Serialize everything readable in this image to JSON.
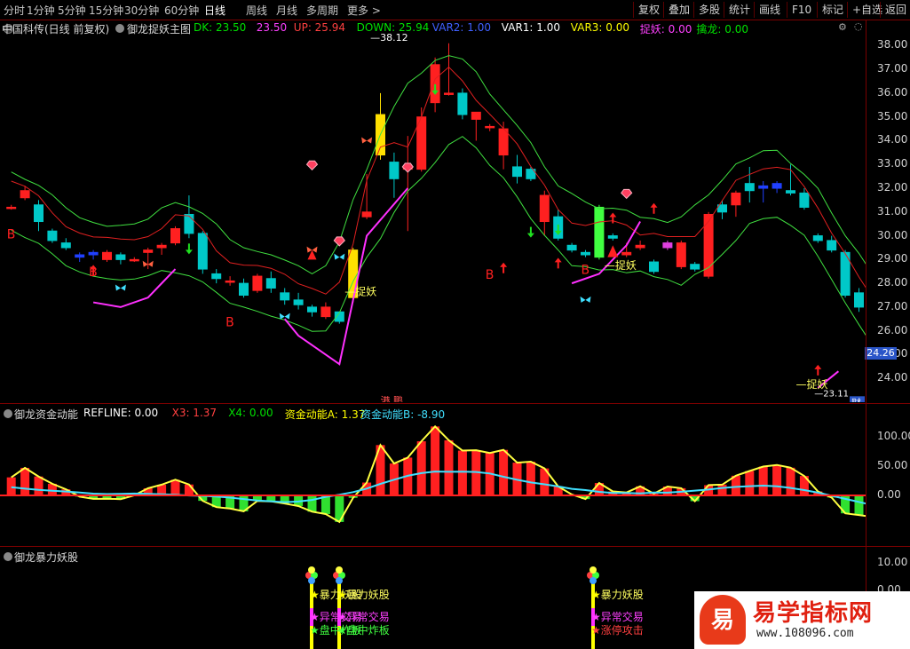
{
  "toolbar": {
    "periods": [
      "分时",
      "1分钟",
      "5分钟",
      "15分钟",
      "30分钟",
      "60分钟",
      "日线",
      "周线",
      "月线",
      "多周期",
      "更多 >"
    ],
    "active_period": "日线",
    "buttons": [
      "复权",
      "叠加",
      "多股",
      "统计",
      "画线",
      "F10",
      "标记",
      "+自选",
      "返回"
    ]
  },
  "main_info": {
    "stock": "中国科传(日线 前复权)",
    "indicator": "御龙捉妖主图",
    "items": [
      {
        "text": "DK: 23.50",
        "color": "#00e000"
      },
      {
        "text": "23.50",
        "color": "#ff40ff"
      },
      {
        "text": "UP: 25.94",
        "color": "#ff4040"
      },
      {
        "text": "DOWN: 25.94",
        "color": "#00e000"
      },
      {
        "text": "VAR2: 1.00",
        "color": "#4060ff"
      },
      {
        "text": "VAR1: 1.00",
        "color": "#ffffff"
      },
      {
        "text": "VAR3: 0.00",
        "color": "#ffff00"
      },
      {
        "text": "捉妖: 0.00",
        "color": "#ff40ff"
      },
      {
        "text": "擒龙: 0.00",
        "color": "#00e000"
      }
    ]
  },
  "price_axis": {
    "labels": [
      "38.00",
      "37.00",
      "36.00",
      "35.00",
      "34.00",
      "33.00",
      "32.00",
      "31.00",
      "30.00",
      "29.00",
      "28.00",
      "27.00",
      "26.00",
      "25.00",
      "24.00"
    ],
    "current": "24.26",
    "high_marker": "38.12",
    "low_marker": "23.11"
  },
  "annotations": {
    "b": "B",
    "zhuoyao": "捉妖",
    "ganggu": "港 鹏",
    "cai": "财"
  },
  "fund_info": {
    "title": "御龙资金动能",
    "items": [
      {
        "text": "REFLINE: 0.00",
        "color": "#ffffff"
      },
      {
        "text": "X3: 1.37",
        "color": "#ff4040"
      },
      {
        "text": "X4: 0.00",
        "color": "#00e000"
      },
      {
        "text": "资金动能A: 1.37",
        "color": "#ffff00"
      },
      {
        "text": "资金动能B: -8.90",
        "color": "#40e0ff"
      }
    ],
    "axis": [
      "100.00",
      "50.00",
      "0.00"
    ]
  },
  "burst_info": {
    "title": "御龙暴力妖股",
    "axis": [
      "10.00",
      "0.00"
    ],
    "labels_a": [
      "暴力妖股",
      "异常交易",
      "盘中炸板"
    ],
    "labels_b": [
      "暴力妖股",
      "异常交易",
      "涨停攻击"
    ]
  },
  "watermark": {
    "logo_char": "易",
    "title": "易学指标网",
    "url": "www.108096.com"
  },
  "chart_data": {
    "type": "candlestick",
    "title": "中国科传(日线 前复权)",
    "ylim": [
      23.0,
      38.5
    ],
    "candles": [
      [
        31.2,
        31.3,
        31.1,
        31.2
      ],
      [
        31.6,
        32.1,
        31.5,
        31.9
      ],
      [
        31.3,
        31.5,
        30.2,
        30.6
      ],
      [
        30.2,
        30.3,
        29.7,
        29.8
      ],
      [
        29.7,
        29.9,
        29.4,
        29.5
      ],
      [
        29.2,
        29.3,
        28.9,
        29.1
      ],
      [
        29.3,
        29.4,
        29.0,
        29.2
      ],
      [
        29.0,
        29.4,
        28.9,
        29.3
      ],
      [
        29.2,
        29.3,
        28.8,
        29.0
      ],
      [
        29.0,
        29.1,
        28.9,
        29.0
      ],
      [
        29.3,
        29.5,
        28.6,
        29.4
      ],
      [
        29.5,
        29.7,
        29.2,
        29.6
      ],
      [
        29.7,
        30.4,
        29.6,
        30.3
      ],
      [
        30.9,
        31.7,
        29.9,
        30.1
      ],
      [
        30.1,
        30.2,
        28.4,
        28.6
      ],
      [
        28.4,
        28.6,
        28.0,
        28.2
      ],
      [
        28.1,
        28.3,
        27.9,
        28.1
      ],
      [
        28.0,
        28.2,
        27.4,
        27.5
      ],
      [
        27.7,
        28.4,
        27.6,
        28.3
      ],
      [
        28.2,
        28.5,
        27.6,
        27.8
      ],
      [
        27.6,
        27.8,
        27.1,
        27.3
      ],
      [
        27.3,
        27.6,
        26.9,
        27.1
      ],
      [
        27.0,
        27.1,
        26.6,
        26.8
      ],
      [
        26.6,
        27.2,
        26.5,
        27.0
      ],
      [
        26.8,
        26.8,
        26.3,
        26.4
      ],
      [
        27.4,
        29.5,
        27.2,
        29.4
      ],
      [
        30.8,
        32.6,
        30.7,
        31.0
      ],
      [
        33.4,
        36.0,
        33.2,
        35.1
      ],
      [
        33.1,
        33.5,
        31.6,
        32.4
      ],
      [
        32.8,
        34.2,
        30.2,
        32.9
      ],
      [
        32.8,
        35.4,
        32.7,
        35.0
      ],
      [
        35.6,
        37.5,
        35.2,
        37.2
      ],
      [
        36.0,
        38.1,
        35.9,
        36.0
      ],
      [
        36.0,
        36.2,
        34.9,
        35.1
      ],
      [
        34.9,
        35.2,
        34.0,
        35.2
      ],
      [
        34.6,
        34.7,
        34.4,
        34.6
      ],
      [
        33.4,
        34.8,
        32.8,
        34.5
      ],
      [
        32.9,
        33.4,
        32.2,
        32.5
      ],
      [
        32.8,
        32.9,
        32.3,
        32.4
      ],
      [
        30.6,
        31.9,
        30.0,
        31.7
      ],
      [
        30.8,
        31.1,
        29.8,
        29.9
      ],
      [
        29.6,
        29.7,
        29.3,
        29.4
      ],
      [
        29.3,
        29.4,
        29.1,
        29.2
      ],
      [
        29.1,
        31.3,
        29.0,
        31.2
      ],
      [
        30.0,
        30.1,
        29.8,
        29.9
      ],
      [
        29.2,
        29.7,
        29.1,
        29.3
      ],
      [
        29.5,
        29.8,
        29.4,
        29.6
      ],
      [
        28.9,
        29.0,
        28.4,
        28.5
      ],
      [
        29.7,
        29.8,
        29.4,
        29.5
      ],
      [
        28.7,
        29.8,
        28.6,
        29.7
      ],
      [
        28.8,
        28.9,
        28.5,
        28.6
      ],
      [
        28.3,
        31.0,
        28.2,
        30.9
      ],
      [
        31.3,
        31.5,
        30.7,
        31.0
      ],
      [
        31.3,
        31.9,
        30.8,
        31.8
      ],
      [
        32.2,
        32.9,
        31.4,
        31.9
      ],
      [
        32.1,
        32.3,
        31.4,
        32.0
      ],
      [
        32.2,
        32.3,
        31.8,
        32.0
      ],
      [
        31.9,
        33.0,
        31.7,
        31.8
      ],
      [
        31.8,
        32.0,
        31.1,
        31.2
      ],
      [
        30.0,
        30.1,
        29.7,
        29.8
      ],
      [
        29.8,
        30.0,
        29.3,
        29.4
      ],
      [
        29.3,
        29.4,
        27.4,
        27.5
      ],
      [
        27.6,
        27.8,
        26.8,
        27.0
      ],
      [
        27.1,
        27.2,
        26.2,
        26.3
      ],
      [
        26.3,
        26.4,
        25.1,
        25.2
      ],
      [
        25.4,
        25.6,
        24.9,
        25.1
      ],
      [
        25.4,
        25.6,
        24.9,
        25.0
      ],
      [
        24.2,
        24.3,
        23.3,
        23.4
      ],
      [
        23.6,
        25.6,
        23.5,
        25.5
      ],
      [
        25.6,
        26.3,
        25.6,
        26.1
      ],
      [
        25.3,
        25.5,
        25.2,
        25.4
      ],
      [
        25.1,
        25.4,
        25.0,
        25.2
      ],
      [
        25.2,
        26.5,
        25.1,
        26.2
      ]
    ]
  }
}
